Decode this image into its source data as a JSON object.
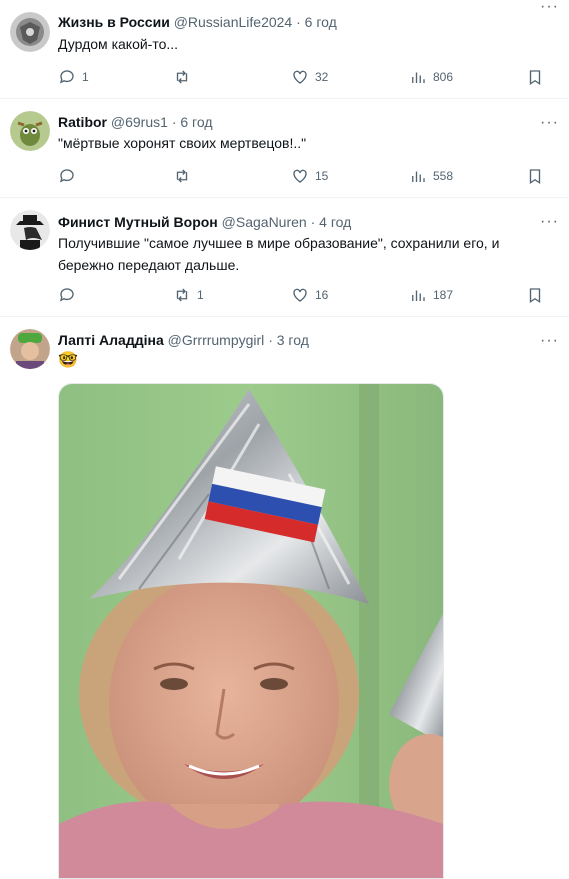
{
  "posts": [
    {
      "name": "Жизнь в России",
      "handle": "@RussianLife2024",
      "time": "6 год",
      "text": "Дурдом какой-то...",
      "replies": "1",
      "reposts": "",
      "likes": "32",
      "views": "806"
    },
    {
      "name": "Ratibor",
      "handle": "@69rus1",
      "time": "6 год",
      "text": "\"мёртвые хоронят своих мертвецов!..\"",
      "replies": "",
      "reposts": "",
      "likes": "15",
      "views": "558"
    },
    {
      "name": "Финист Мутный Ворон",
      "handle": "@SagaNuren",
      "time": "4 год",
      "text": "Получившие \"самое лучшее в мире образование\", сохранили его, и бережно передают дальше.",
      "replies": "",
      "reposts": "1",
      "likes": "16",
      "views": "187"
    },
    {
      "name": "Лапті Аладдіна",
      "handle": "@Grrrrumpygirl",
      "time": "3 год",
      "text": "🤓"
    }
  ],
  "separator": "·",
  "more_label": "···",
  "colors": {
    "text": "#0f1419",
    "secondary": "#536471",
    "divider": "#eff3f4"
  },
  "icons": [
    "reply-icon",
    "repost-icon",
    "like-icon",
    "views-icon",
    "bookmark-icon",
    "more-icon"
  ]
}
